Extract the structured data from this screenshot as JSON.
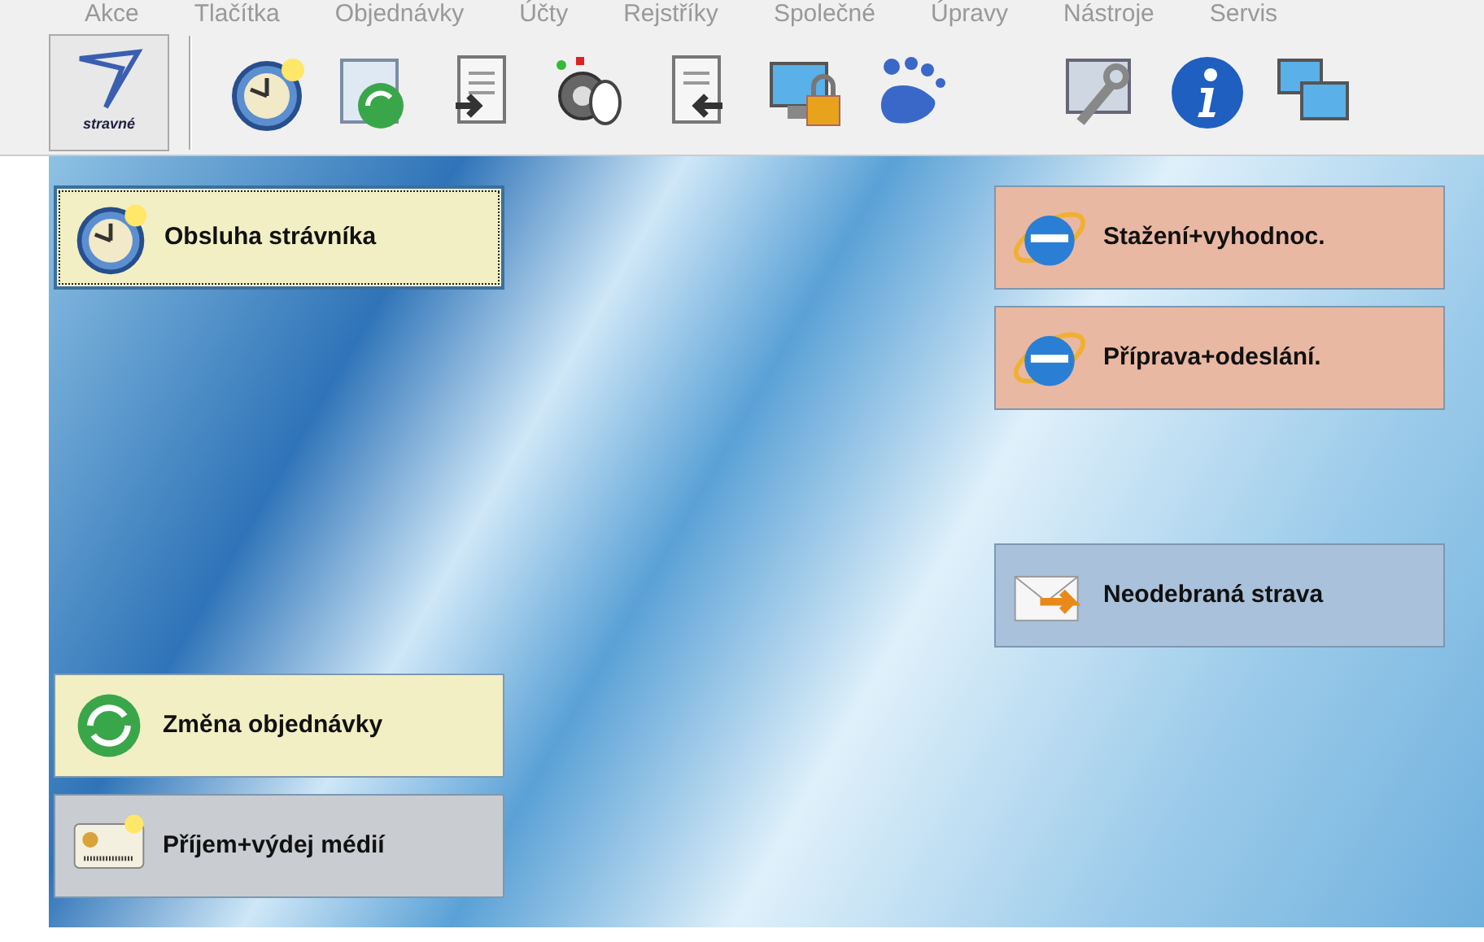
{
  "menu": [
    "Akce",
    "Tlačítka",
    "Objednávky",
    "Účty",
    "Rejstříky",
    "Společné",
    "Úpravy",
    "Nástroje",
    "Servis"
  ],
  "toolbar": {
    "logo_text": "stravné"
  },
  "left_buttons": [
    {
      "label": "Obsluha strávníka",
      "color": "#f2efc4",
      "focused": true
    },
    {
      "label": "Změna objednávky",
      "color": "#f2efc4",
      "focused": false
    },
    {
      "label": "Příjem+výdej médií",
      "color": "#c9ccd0",
      "focused": false
    }
  ],
  "right_buttons": [
    {
      "label": "Stažení+vyhodnoc.",
      "color": "#e9b8a3",
      "focused": false
    },
    {
      "label": "Příprava+odeslání.",
      "color": "#e9b8a3",
      "focused": false
    },
    {
      "label": "Neodebraná strava",
      "color": "#a9c1da",
      "focused": false
    }
  ]
}
